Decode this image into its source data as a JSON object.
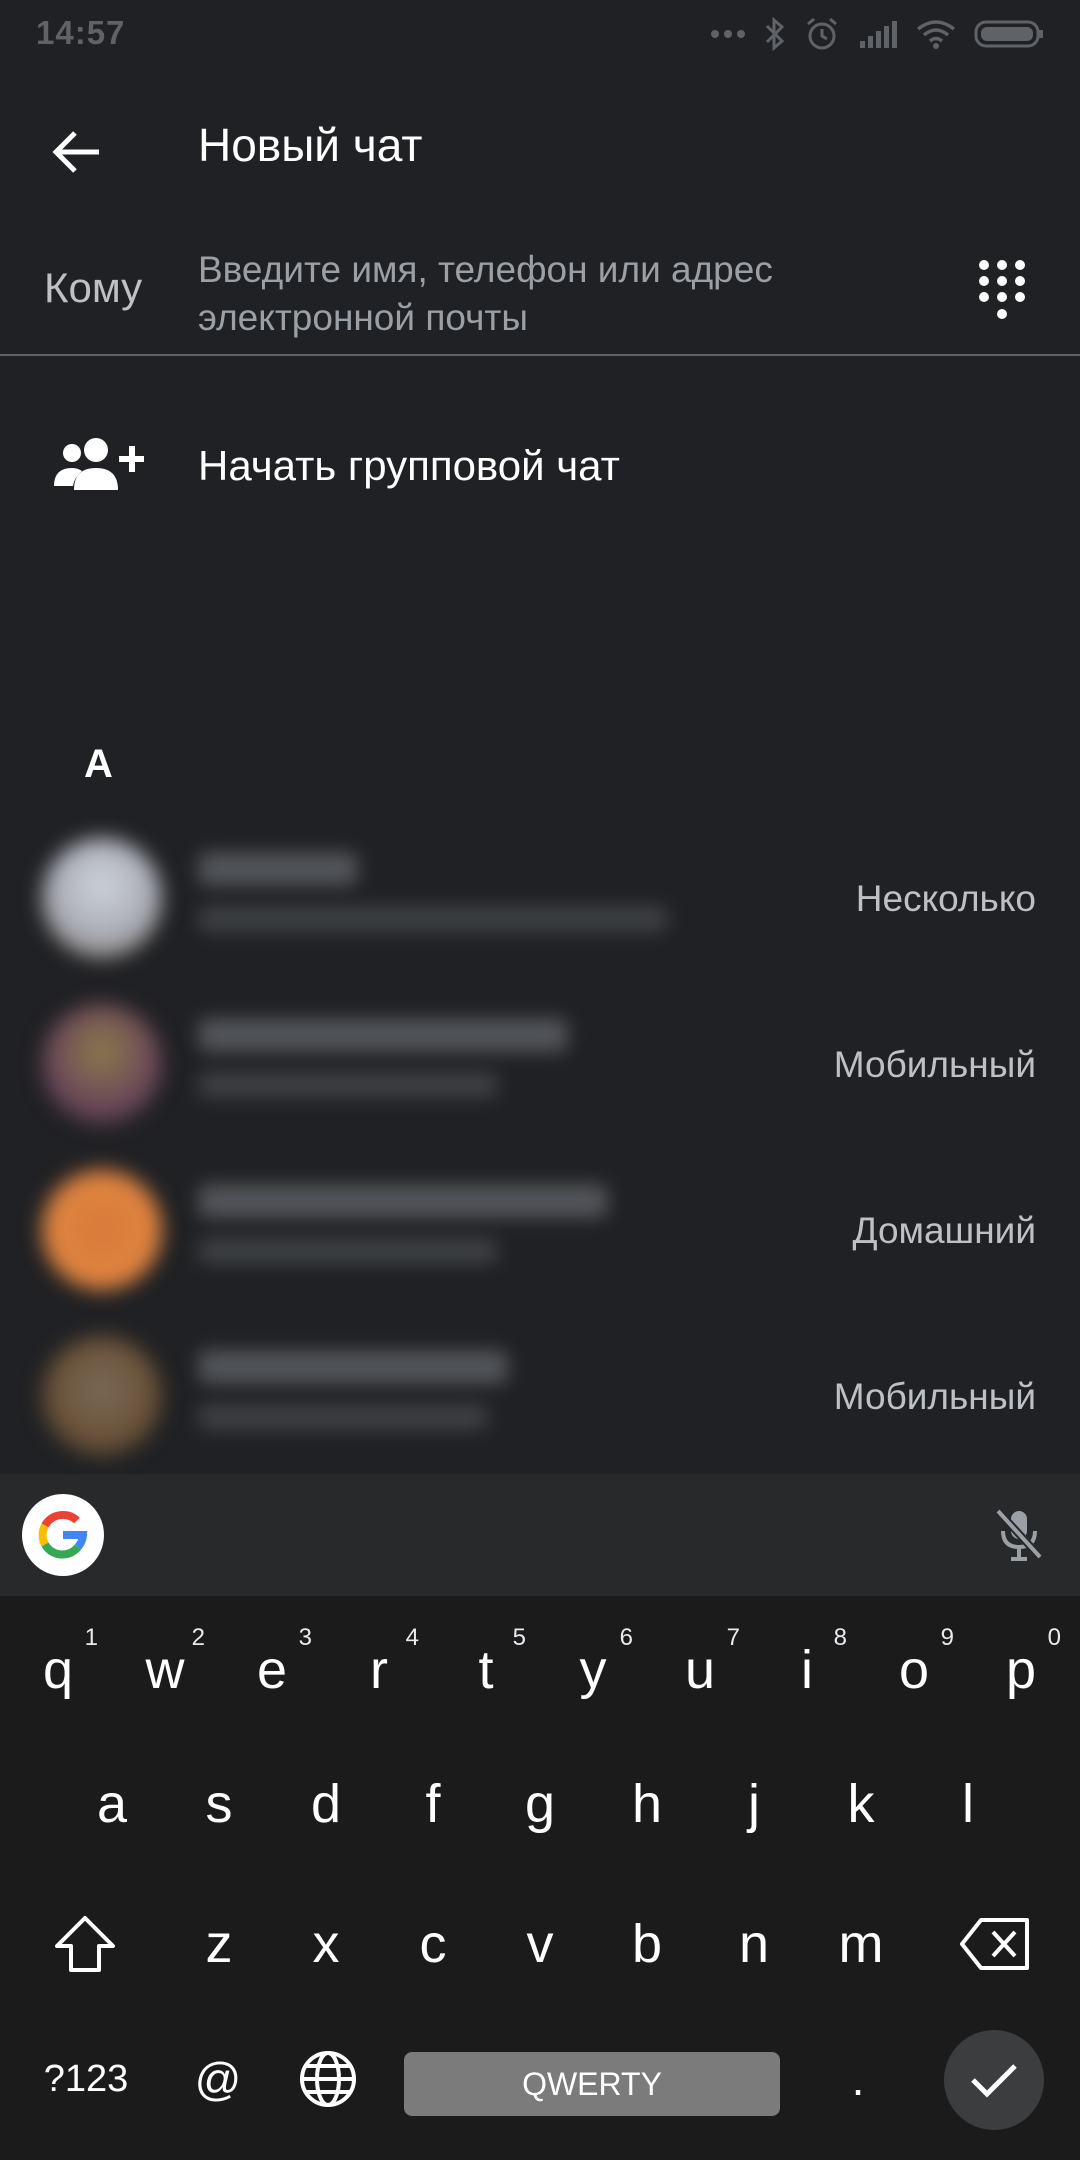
{
  "status_bar": {
    "time": "14:57"
  },
  "app_bar": {
    "title": "Новый чат"
  },
  "to_field": {
    "label": "Кому",
    "placeholder_line1": "Введите имя, телефон или адрес",
    "placeholder_line2": "электронной почты"
  },
  "group_chat": {
    "label": "Начать групповой чат"
  },
  "section": {
    "letter": "A"
  },
  "contacts": [
    {
      "type": "Несколько",
      "avatar_color": "#b9bcc4"
    },
    {
      "type": "Мобильный",
      "avatar_color": "#6e4a5a"
    },
    {
      "type": "Домашний",
      "avatar_color": "#e08440"
    },
    {
      "type": "Мобильный",
      "avatar_color": "#6a5238"
    }
  ],
  "keyboard": {
    "row1": [
      {
        "k": "q",
        "h": "1"
      },
      {
        "k": "w",
        "h": "2"
      },
      {
        "k": "e",
        "h": "3"
      },
      {
        "k": "r",
        "h": "4"
      },
      {
        "k": "t",
        "h": "5"
      },
      {
        "k": "y",
        "h": "6"
      },
      {
        "k": "u",
        "h": "7"
      },
      {
        "k": "i",
        "h": "8"
      },
      {
        "k": "o",
        "h": "9"
      },
      {
        "k": "p",
        "h": "0"
      }
    ],
    "row2": [
      "a",
      "s",
      "d",
      "f",
      "g",
      "h",
      "j",
      "k",
      "l"
    ],
    "row3": [
      "z",
      "x",
      "c",
      "v",
      "b",
      "n",
      "m"
    ],
    "symbols": "?123",
    "at": "@",
    "space_label": "QWERTY",
    "period": "."
  },
  "colors": {
    "background": "#202124",
    "keyboard_bg": "#1b1b1c",
    "divider": "#5f6368"
  }
}
